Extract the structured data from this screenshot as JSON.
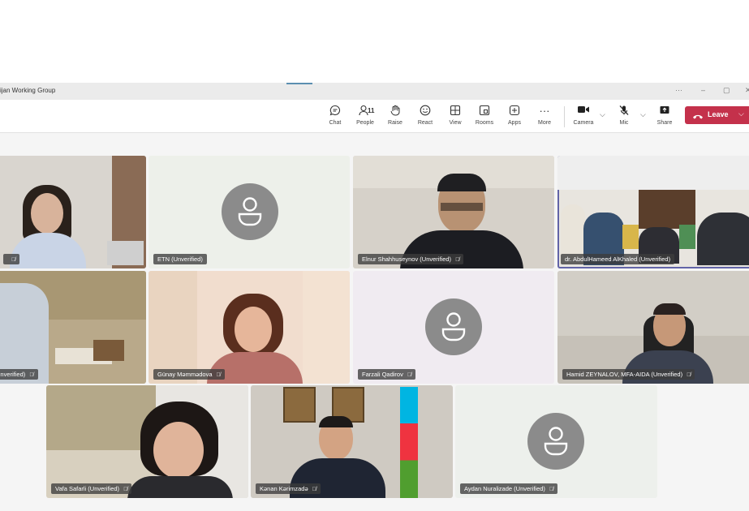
{
  "window": {
    "title": "ijan Working Group"
  },
  "toolbar": {
    "chat": "Chat",
    "people": "People",
    "people_count": "11",
    "raise": "Raise",
    "react": "React",
    "view": "View",
    "rooms": "Rooms",
    "apps": "Apps",
    "more": "More",
    "camera": "Camera",
    "mic": "Mic",
    "share": "Share",
    "leave": "Leave"
  },
  "participants": [
    {
      "name": ""
    },
    {
      "name": "ETN (Unverified)"
    },
    {
      "name": "Elnur Shahhuseynov (Unverified)"
    },
    {
      "name": "dr. AbdulHameed AlKhaled (Unverified)"
    },
    {
      "name": "Unverified)"
    },
    {
      "name": "Günay Məmmədova"
    },
    {
      "name": "Farzali Qadirov"
    },
    {
      "name": "Hamid ZEYNALOV, MFA-AIDA (Unverified)"
    },
    {
      "name": "Vafa Safarli (Unverified)"
    },
    {
      "name": "Kənan Kərimzadə"
    },
    {
      "name": "Aydan Nuralizade (Unverified)"
    }
  ],
  "colors": {
    "leave": "#c4314b",
    "selected_border": "#6264a7",
    "avatar": "#8b8b8b"
  },
  "icons": [
    "chat-icon",
    "people-icon",
    "raise-hand-icon",
    "react-icon",
    "view-icon",
    "rooms-icon",
    "apps-icon",
    "more-icon",
    "camera-icon",
    "mic-off-icon",
    "share-icon",
    "phone-icon",
    "person-icon",
    "mic-muted-icon"
  ]
}
